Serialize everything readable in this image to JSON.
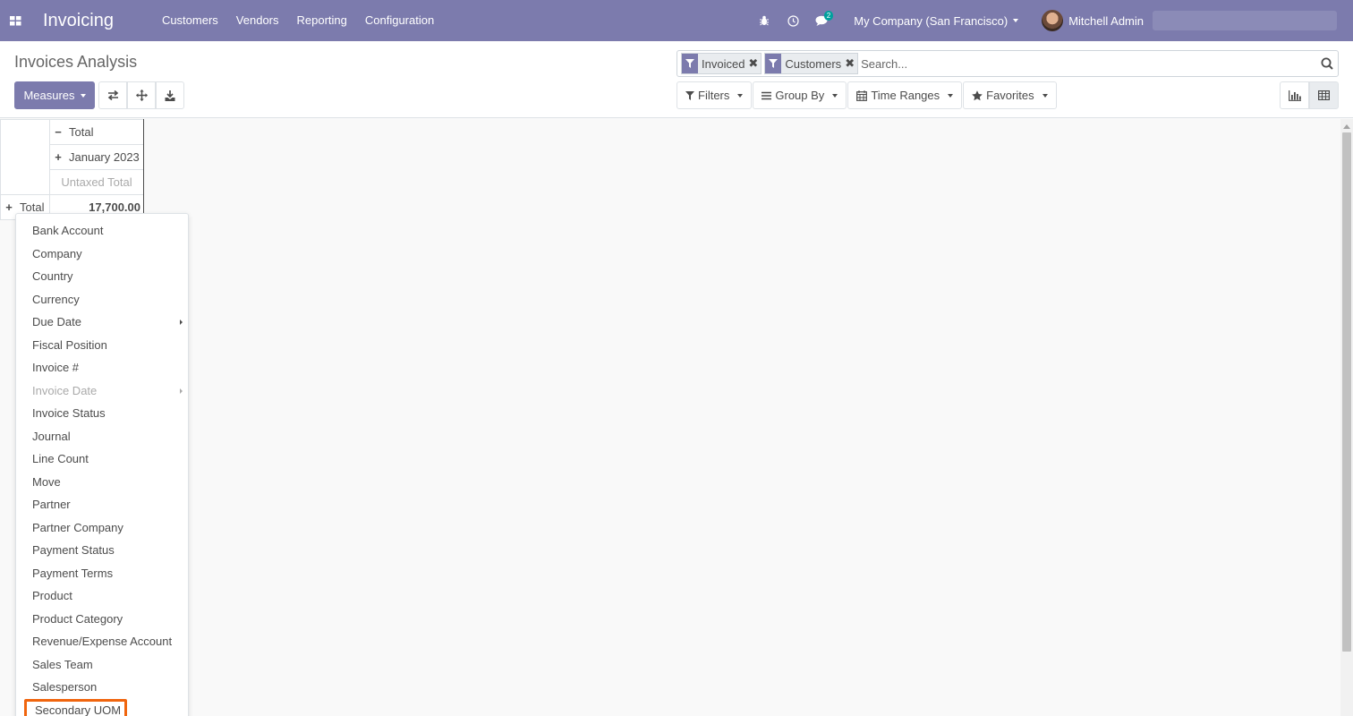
{
  "app": {
    "title": "Invoicing"
  },
  "menu": [
    "Customers",
    "Vendors",
    "Reporting",
    "Configuration"
  ],
  "systray": {
    "messages_count": "2",
    "company": "My Company (San Francisco)",
    "user": "Mitchell Admin"
  },
  "page": {
    "breadcrumb": "Invoices Analysis"
  },
  "toolbar": {
    "measures_label": "Measures"
  },
  "search": {
    "facets": [
      {
        "label": "Invoiced"
      },
      {
        "label": "Customers"
      }
    ],
    "placeholder": "Search..."
  },
  "filters": {
    "filters": "Filters",
    "group_by": "Group By",
    "time_ranges": "Time Ranges",
    "favorites": "Favorites"
  },
  "pivot": {
    "col_total": "Total",
    "col_sub": "January 2023",
    "measure": "Untaxed Total",
    "row_total": "Total",
    "value": "17,700.00"
  },
  "dropdown": {
    "items": [
      {
        "label": "Bank Account"
      },
      {
        "label": "Company"
      },
      {
        "label": "Country"
      },
      {
        "label": "Currency"
      },
      {
        "label": "Due Date"
      },
      {
        "label": "Fiscal Position"
      },
      {
        "label": "Invoice #"
      },
      {
        "label": "Invoice Date"
      },
      {
        "label": "Invoice Status"
      },
      {
        "label": "Journal"
      },
      {
        "label": "Line Count"
      },
      {
        "label": "Move"
      },
      {
        "label": "Partner"
      },
      {
        "label": "Partner Company"
      },
      {
        "label": "Payment Status"
      },
      {
        "label": "Payment Terms"
      },
      {
        "label": "Product"
      },
      {
        "label": "Product Category"
      },
      {
        "label": "Revenue/Expense Account"
      },
      {
        "label": "Sales Team"
      },
      {
        "label": "Salesperson"
      },
      {
        "label": "Secondary UOM"
      }
    ]
  },
  "colors": {
    "brand": "#7c7bad",
    "highlight": "#f0650e",
    "badge": "#00a09d"
  }
}
